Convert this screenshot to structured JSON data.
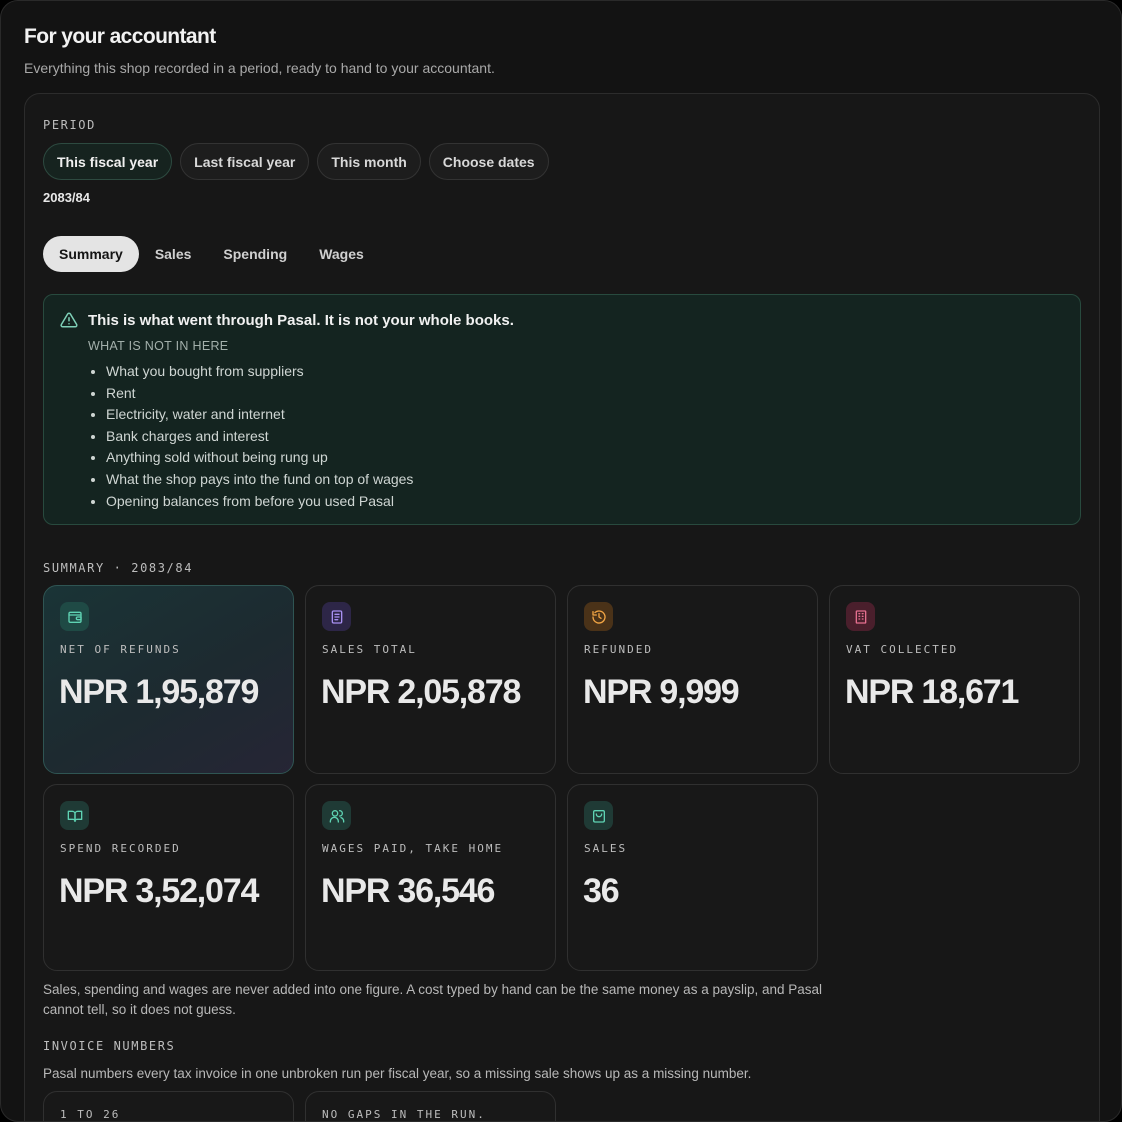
{
  "page": {
    "title": "For your accountant",
    "subtitle": "Everything this shop recorded in a period, ready to hand to your accountant."
  },
  "period": {
    "label": "PERIOD",
    "options": [
      "This fiscal year",
      "Last fiscal year",
      "This month",
      "Choose dates"
    ],
    "selected": "This fiscal year",
    "value": "2083/84"
  },
  "tabs": {
    "items": [
      "Summary",
      "Sales",
      "Spending",
      "Wages"
    ],
    "active": "Summary"
  },
  "notice": {
    "icon": "warning-triangle-icon",
    "title": "This is what went through Pasal. It is not your whole books.",
    "subtitle": "WHAT IS NOT IN HERE",
    "items": [
      "What you bought from suppliers",
      "Rent",
      "Electricity, water and internet",
      "Bank charges and interest",
      "Anything sold without being rung up",
      "What the shop pays into the fund on top of wages",
      "Opening balances from before you used Pasal"
    ],
    "accent": "#284a3e"
  },
  "summary": {
    "label": "SUMMARY · 2083/84",
    "cards": [
      {
        "label": "NET OF REFUNDS",
        "value": "NPR 1,95,879",
        "icon": "wallet-icon",
        "color": "#3fbfa0"
      },
      {
        "label": "SALES TOTAL",
        "value": "NPR 2,05,878",
        "icon": "receipt-icon",
        "color": "#a48cf0"
      },
      {
        "label": "REFUNDED",
        "value": "NPR 9,999",
        "icon": "history-icon",
        "color": "#f0a040"
      },
      {
        "label": "VAT COLLECTED",
        "value": "NPR 18,671",
        "icon": "building-icon",
        "color": "#e06a8a"
      },
      {
        "label": "SPEND RECORDED",
        "value": "NPR 3,52,074",
        "icon": "book-icon",
        "color": "#3fbfa0"
      },
      {
        "label": "WAGES PAID, TAKE HOME",
        "value": "NPR 36,546",
        "icon": "users-icon",
        "color": "#3fbfa0"
      },
      {
        "label": "SALES",
        "value": "36",
        "icon": "shopping-bag-icon",
        "color": "#3fbfa0"
      }
    ],
    "note": "Sales, spending and wages are never added into one figure. A cost typed by hand can be the same money as a payslip, and Pasal cannot tell, so it does not guess."
  },
  "invoice": {
    "label": "INVOICE NUMBERS",
    "subtitle": "Pasal numbers every tax invoice in one unbroken run per fiscal year, so a missing sale shows up as a missing number.",
    "cards": [
      {
        "text": "1 TO 26"
      },
      {
        "text": "NO GAPS IN THE RUN."
      }
    ]
  }
}
